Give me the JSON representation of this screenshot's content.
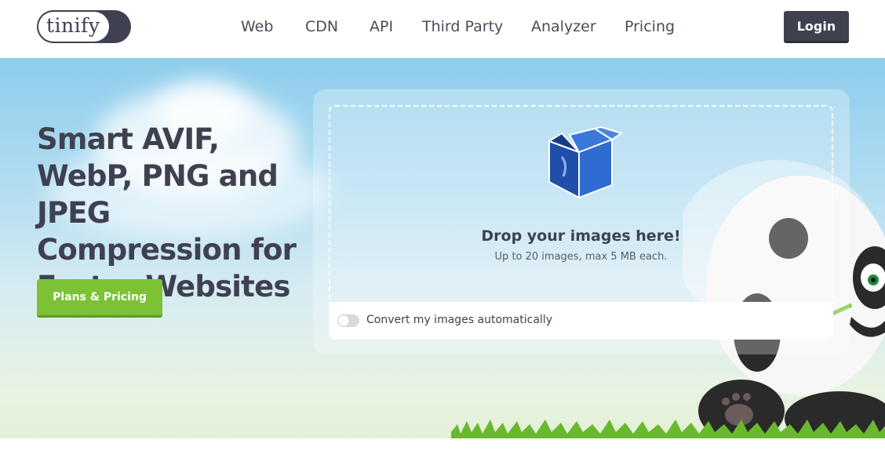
{
  "header": {
    "logo_text": "tinify",
    "nav": {
      "web": "Web",
      "cdn": "CDN",
      "api": "API",
      "third_party": "Third Party",
      "analyzer": "Analyzer",
      "pricing": "Pricing"
    },
    "login_label": "Login"
  },
  "hero": {
    "headline": "Smart AVIF, WebP, PNG and JPEG Compression for Faster Websites",
    "plans_button": "Plans & Pricing"
  },
  "dropzone": {
    "title": "Drop your images here!",
    "subtitle": "Up to 20 images, max 5 MB each.",
    "convert_label": "Convert my images automatically",
    "convert_enabled": false
  },
  "colors": {
    "brand_dark": "#3f4150",
    "accent_green": "#7cc234",
    "sky": "#8ecdec"
  },
  "icons": [
    "box-icon",
    "panda-mascot",
    "toggle-switch"
  ]
}
